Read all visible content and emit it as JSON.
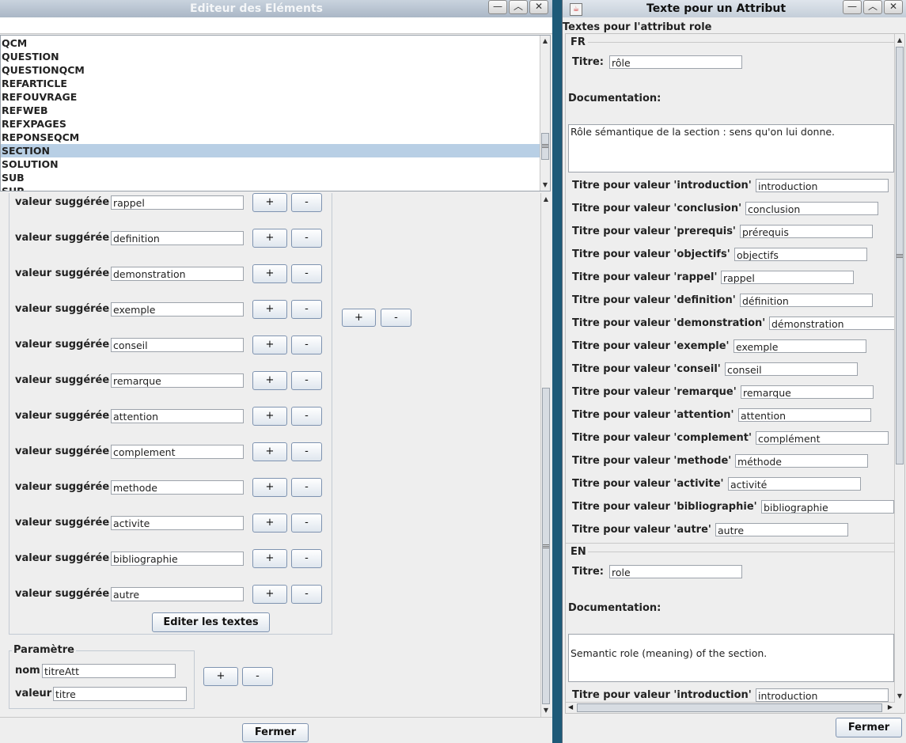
{
  "editor": {
    "title": "Editeur des Eléments",
    "list_items": [
      {
        "text": "QCM",
        "selected": false
      },
      {
        "text": "QUESTION",
        "selected": false
      },
      {
        "text": "QUESTIONQCM",
        "selected": false
      },
      {
        "text": "REFARTICLE",
        "selected": false
      },
      {
        "text": "REFOUVRAGE",
        "selected": false
      },
      {
        "text": "REFWEB",
        "selected": false
      },
      {
        "text": "REFXPAGES",
        "selected": false
      },
      {
        "text": "REPONSEQCM",
        "selected": false
      },
      {
        "text": "SECTION",
        "selected": true
      },
      {
        "text": "SOLUTION",
        "selected": false
      },
      {
        "text": "SUB",
        "selected": false
      },
      {
        "text": "SUP",
        "selected": false
      }
    ],
    "suggested_label": "valeur suggérée",
    "suggested_values": [
      "rappel",
      "definition",
      "demonstration",
      "exemple",
      "conseil",
      "remarque",
      "attention",
      "complement",
      "methode",
      "activite",
      "bibliographie",
      "autre"
    ],
    "plus_label": "+",
    "minus_label": "-",
    "edit_texts_button": "Editer les textes",
    "parametre": {
      "legend": "Paramètre",
      "nom_label": "nom",
      "nom_value": "titreAtt",
      "valeur_label": "valeur",
      "valeur_value": "titre"
    },
    "close_button": "Fermer"
  },
  "texts_dialog": {
    "title": "Texte pour un Attribut",
    "header": "Textes pour l'attribut role",
    "fr": {
      "legend": "FR",
      "titre_label": "Titre:",
      "titre_value": "rôle",
      "doc_label": "Documentation:",
      "doc_text": "Rôle sémantique de la section : sens qu'on lui donne.",
      "value_titles": [
        {
          "label": "Titre pour valeur 'introduction'",
          "value": "introduction"
        },
        {
          "label": "Titre pour valeur 'conclusion'",
          "value": "conclusion"
        },
        {
          "label": "Titre pour valeur 'prerequis'",
          "value": "prérequis"
        },
        {
          "label": "Titre pour valeur 'objectifs'",
          "value": "objectifs"
        },
        {
          "label": "Titre pour valeur 'rappel'",
          "value": "rappel"
        },
        {
          "label": "Titre pour valeur 'definition'",
          "value": "définition"
        },
        {
          "label": "Titre pour valeur 'demonstration'",
          "value": "démonstration"
        },
        {
          "label": "Titre pour valeur 'exemple'",
          "value": "exemple"
        },
        {
          "label": "Titre pour valeur 'conseil'",
          "value": "conseil"
        },
        {
          "label": "Titre pour valeur 'remarque'",
          "value": "remarque"
        },
        {
          "label": "Titre pour valeur 'attention'",
          "value": "attention"
        },
        {
          "label": "Titre pour valeur 'complement'",
          "value": "complément"
        },
        {
          "label": "Titre pour valeur 'methode'",
          "value": "méthode"
        },
        {
          "label": "Titre pour valeur 'activite'",
          "value": "activité"
        },
        {
          "label": "Titre pour valeur 'bibliographie'",
          "value": "bibliographie"
        },
        {
          "label": "Titre pour valeur 'autre'",
          "value": "autre"
        }
      ]
    },
    "en": {
      "legend": "EN",
      "titre_label": "Titre:",
      "titre_value": "role",
      "doc_label": "Documentation:",
      "doc_text": "Semantic role (meaning) of the section.",
      "value_titles": [
        {
          "label": "Titre pour valeur 'introduction'",
          "value": "introduction"
        }
      ]
    },
    "close_button": "Fermer"
  }
}
